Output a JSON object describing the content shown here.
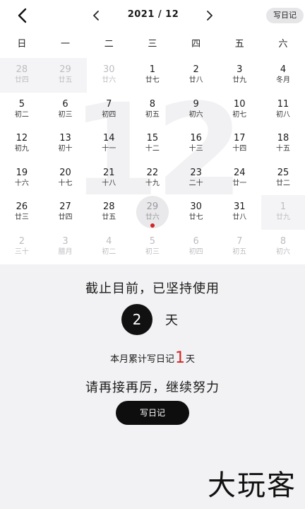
{
  "header": {
    "back_icon": "chevron-left-icon",
    "month_title": "2021 / 12",
    "prev_icon": "chevron-left-icon",
    "next_icon": "chevron-right-icon",
    "diary_chip": "写日记"
  },
  "calendar": {
    "watermark": "12",
    "weekdays": [
      "日",
      "一",
      "二",
      "三",
      "四",
      "五",
      "六"
    ],
    "days": [
      {
        "d": "28",
        "l": "廿四",
        "other": true
      },
      {
        "d": "29",
        "l": "廿五",
        "other": true
      },
      {
        "d": "30",
        "l": "廿六",
        "other": true
      },
      {
        "d": "1",
        "l": "廿七"
      },
      {
        "d": "2",
        "l": "廿八"
      },
      {
        "d": "3",
        "l": "廿九"
      },
      {
        "d": "4",
        "l": "冬月"
      },
      {
        "d": "5",
        "l": "初二"
      },
      {
        "d": "6",
        "l": "初三"
      },
      {
        "d": "7",
        "l": "初四"
      },
      {
        "d": "8",
        "l": "初五"
      },
      {
        "d": "9",
        "l": "初六"
      },
      {
        "d": "10",
        "l": "初七"
      },
      {
        "d": "11",
        "l": "初八"
      },
      {
        "d": "12",
        "l": "初九"
      },
      {
        "d": "13",
        "l": "初十"
      },
      {
        "d": "14",
        "l": "十一"
      },
      {
        "d": "15",
        "l": "十二"
      },
      {
        "d": "16",
        "l": "十三"
      },
      {
        "d": "17",
        "l": "十四"
      },
      {
        "d": "18",
        "l": "十五"
      },
      {
        "d": "19",
        "l": "十六"
      },
      {
        "d": "20",
        "l": "十七"
      },
      {
        "d": "21",
        "l": "十八"
      },
      {
        "d": "22",
        "l": "十九"
      },
      {
        "d": "23",
        "l": "二十"
      },
      {
        "d": "24",
        "l": "廿一"
      },
      {
        "d": "25",
        "l": "廿二"
      },
      {
        "d": "26",
        "l": "廿三"
      },
      {
        "d": "27",
        "l": "廿四"
      },
      {
        "d": "28",
        "l": "廿五"
      },
      {
        "d": "29",
        "l": "廿六",
        "today": true
      },
      {
        "d": "30",
        "l": "廿七"
      },
      {
        "d": "31",
        "l": "廿八"
      },
      {
        "d": "1",
        "l": "廿九",
        "other": true
      },
      {
        "d": "2",
        "l": "三十",
        "other": true
      },
      {
        "d": "3",
        "l": "腊月",
        "other": true
      },
      {
        "d": "4",
        "l": "初二",
        "other": true
      },
      {
        "d": "5",
        "l": "初三",
        "other": true
      },
      {
        "d": "6",
        "l": "初四",
        "other": true
      },
      {
        "d": "7",
        "l": "初五",
        "other": true
      },
      {
        "d": "8",
        "l": "初六",
        "other": true
      }
    ]
  },
  "stats": {
    "heading": "截止目前，已坚持使用",
    "streak_value": "2",
    "streak_unit": "天",
    "month_prefix": "本月累计写日记",
    "month_count": "1",
    "month_suffix": "天",
    "encourage": "请再接再厉，继续努力",
    "write_button": "写日记"
  },
  "brand": "大玩客",
  "colors": {
    "accent_red": "#d42424",
    "dark": "#111111",
    "background": "#f2f2f4"
  }
}
